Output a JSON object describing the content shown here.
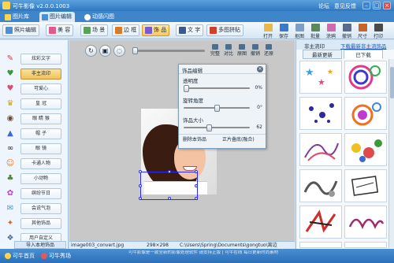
{
  "app": {
    "title": "可牛影像 v2.0.0.1003",
    "links": [
      "论坛",
      "意见反馈"
    ],
    "window_buttons": [
      "minimize",
      "maximize",
      "close"
    ]
  },
  "top_tabs": [
    {
      "label": "图片库",
      "icon": "gallery-icon",
      "active": false
    },
    {
      "label": "图片编辑",
      "icon": "image-edit-icon",
      "active": true
    },
    {
      "label": "动感闪图",
      "icon": "animated-gif-icon",
      "active": false
    }
  ],
  "toolbar": {
    "left": [
      {
        "label": "照片编辑",
        "icon": "photo-edit-icon",
        "active": false
      },
      {
        "label": "美 容",
        "icon": "beauty-icon",
        "active": false
      },
      {
        "label": "场 景",
        "icon": "scene-icon",
        "active": false
      },
      {
        "label": "边 框",
        "icon": "frame-icon",
        "active": false
      },
      {
        "label": "饰 品",
        "icon": "sticker-icon",
        "active": true
      },
      {
        "label": "文 字",
        "icon": "text-icon",
        "active": false
      },
      {
        "label": "多图拼贴",
        "icon": "collage-icon",
        "active": false
      }
    ],
    "right": [
      {
        "label": "打开",
        "icon": "open-icon"
      },
      {
        "label": "保存",
        "icon": "save-icon"
      },
      {
        "label": "抠图",
        "icon": "cutout-icon"
      },
      {
        "label": "批量",
        "icon": "batch-icon"
      },
      {
        "label": "涂鸦",
        "icon": "doodle-icon"
      },
      {
        "label": "撤销",
        "icon": "undo-icon"
      },
      {
        "label": "尺寸",
        "icon": "resize-icon"
      },
      {
        "label": "打印",
        "icon": "print-icon"
      }
    ]
  },
  "left_panel": [
    {
      "label": "炫彩文字",
      "glyph": "✎",
      "color": "#d23a3a"
    },
    {
      "label": "非主流印",
      "glyph": "♥",
      "color": "#3a9a3a",
      "active": true
    },
    {
      "label": "可爱心",
      "glyph": "♥",
      "color": "#e04a7a"
    },
    {
      "label": "皇 冠",
      "glyph": "♛",
      "color": "#d4a020"
    },
    {
      "label": "眼 睛 猴",
      "glyph": "◉",
      "color": "#6a4a2a"
    },
    {
      "label": "帽 子",
      "glyph": "▲",
      "color": "#3a6ad0"
    },
    {
      "label": "眼 镜",
      "glyph": "∞",
      "color": "#222222"
    },
    {
      "label": "卡通人物",
      "glyph": "☺",
      "color": "#e07a20"
    },
    {
      "label": "小动物",
      "glyph": "♣",
      "color": "#4a8a2a"
    },
    {
      "label": "缤纷节日",
      "glyph": "✿",
      "color": "#c03ad0"
    },
    {
      "label": "会说气泡",
      "glyph": "✉",
      "color": "#3aa0d0"
    },
    {
      "label": "其他饰品",
      "glyph": "✦",
      "color": "#d06a2a"
    },
    {
      "label": "用户自定义",
      "glyph": "❖",
      "color": "#4a6a9a"
    }
  ],
  "left_footer": {
    "label": "导入本地饰品"
  },
  "canvas_tools": {
    "buttons": [
      "rotate-icon",
      "fit-window-icon",
      "actual-size-icon"
    ],
    "zoom_labels": [
      "完整",
      "对比",
      "原图",
      "撤销",
      "还原"
    ]
  },
  "dialog": {
    "title": "饰品编辑",
    "fields": [
      {
        "label": "透明度",
        "value": "0%",
        "level": 0.0
      },
      {
        "label": "旋转角度",
        "value": "0°",
        "level": 0.5
      },
      {
        "label": "饰品大小",
        "value": "62",
        "level": 0.38
      }
    ],
    "buttons": [
      "删除本饰品",
      "正片叠底(融合)"
    ]
  },
  "right_panel": {
    "header": "非主流印",
    "link": "下载最新非主流饰品",
    "tabs": [
      {
        "label": "最新更新",
        "active": false
      },
      {
        "label": "已下载",
        "active": true
      }
    ],
    "thumbnails": [
      "stars",
      "circles",
      "butterflies",
      "rings",
      "swirl",
      "flowers",
      "graffiti",
      "sketch",
      "calligraphy",
      "lettering",
      "badge",
      "dots"
    ]
  },
  "status": {
    "filename": "image003_convert.jpg",
    "dimensions": "298×298",
    "path": "C:\\Users\\Spring\\Documents\\gongtuo\\离边"
  },
  "bottom": {
    "links": [
      "可牛首页",
      "可牛秀场"
    ],
    "ticker": "可牛影像是一款全新的影像处理软件 请支持正版 | 可牛在线 每日更新时尚素材"
  },
  "colors": {
    "title_bar": "#2f78c2",
    "active_tool": "#f7c95a",
    "selection": "#2a2aff"
  }
}
